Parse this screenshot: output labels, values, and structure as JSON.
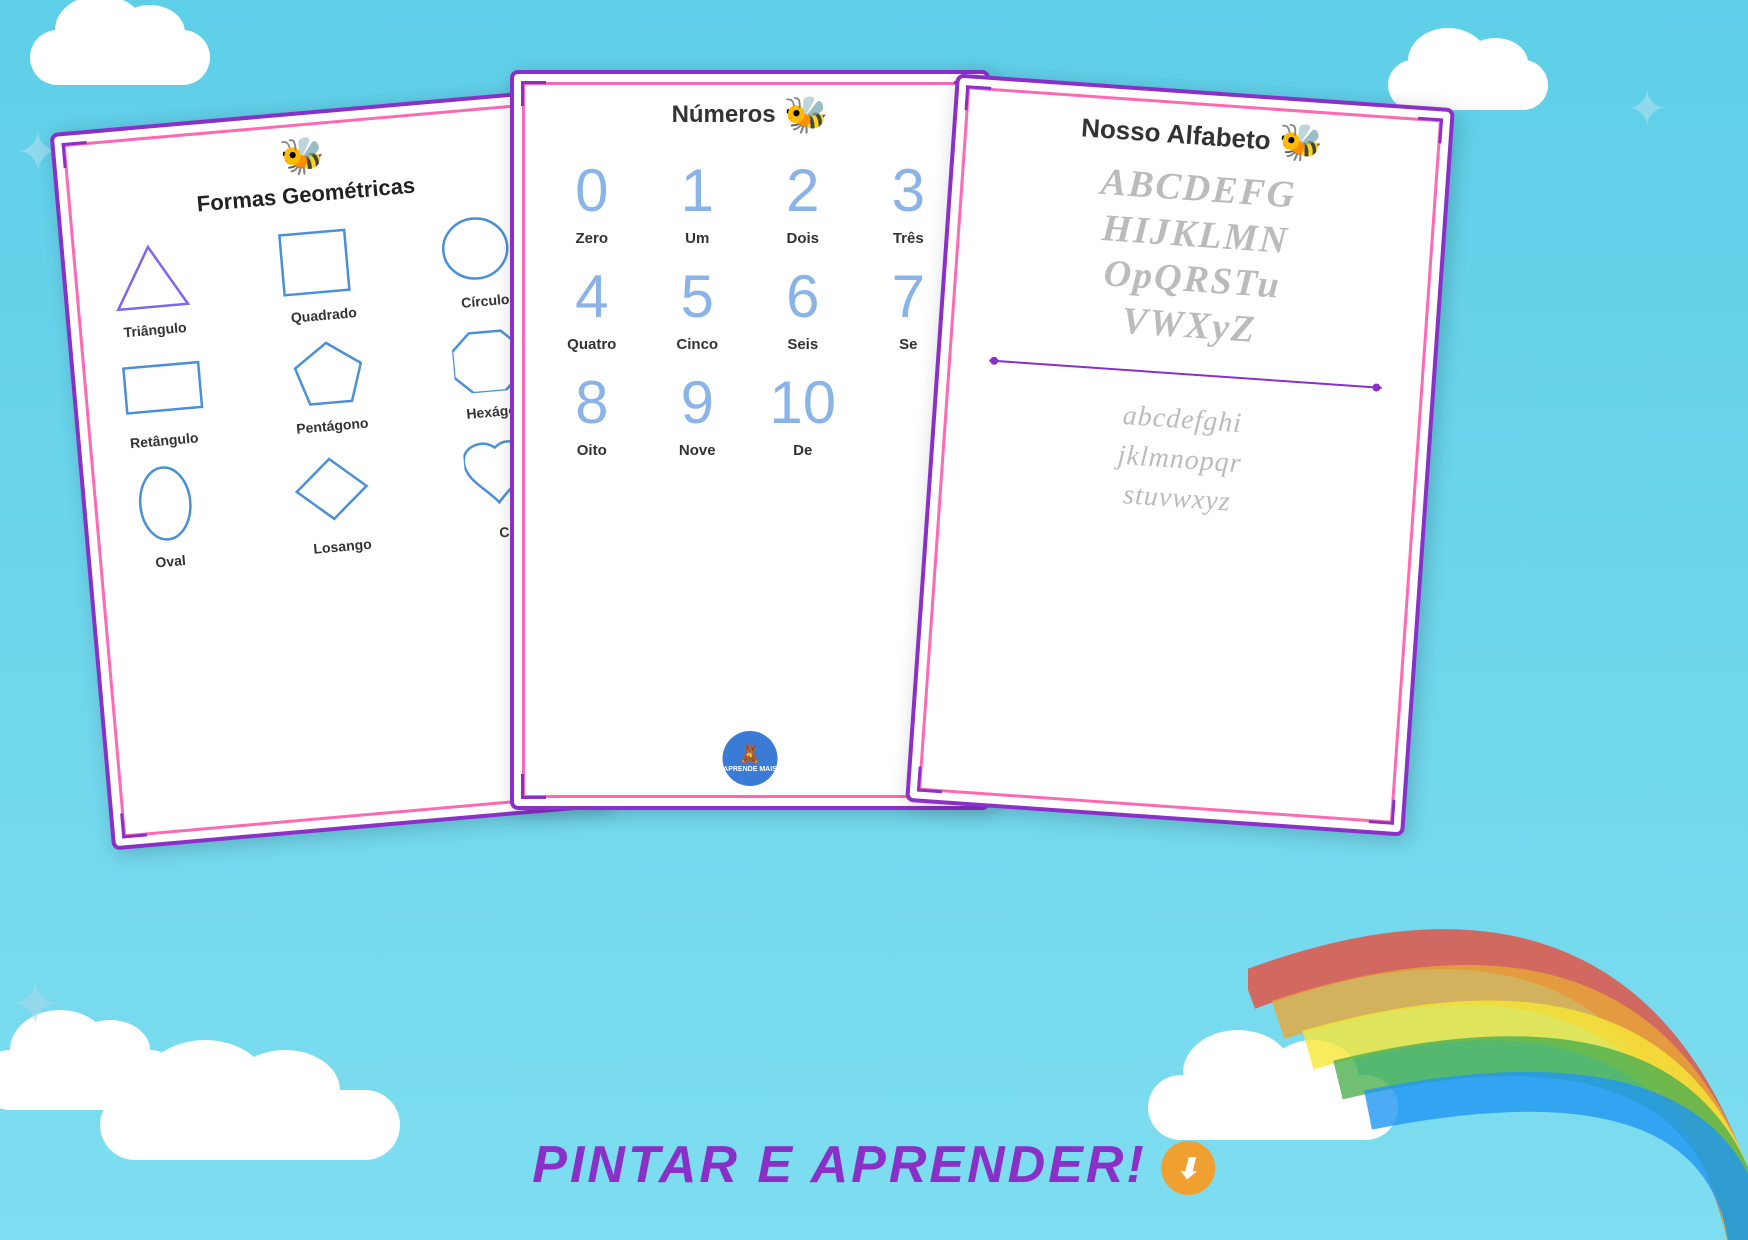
{
  "background": {
    "color": "#5ecfe8"
  },
  "page1": {
    "title": "Formas Geométricas",
    "shapes": [
      {
        "name": "Triângulo",
        "type": "triangle"
      },
      {
        "name": "Quadrado",
        "type": "square"
      },
      {
        "name": "Círculo",
        "type": "circle"
      },
      {
        "name": "Retângulo",
        "type": "rectangle"
      },
      {
        "name": "Pentágono",
        "type": "pentagon"
      },
      {
        "name": "Hexágon",
        "type": "hexagon"
      },
      {
        "name": "Oval",
        "type": "oval"
      },
      {
        "name": "Losango",
        "type": "diamond"
      },
      {
        "name": "Co",
        "type": "heart"
      }
    ]
  },
  "page2": {
    "title": "Números",
    "numbers": [
      {
        "char": "0",
        "label": "Zero"
      },
      {
        "char": "1",
        "label": "Um"
      },
      {
        "char": "2",
        "label": "Dois"
      },
      {
        "char": "3",
        "label": "Três"
      },
      {
        "char": "4",
        "label": "Quatro"
      },
      {
        "char": "5",
        "label": "Cinco"
      },
      {
        "char": "6",
        "label": "Seis"
      },
      {
        "char": "7",
        "label": "Se"
      },
      {
        "char": "8",
        "label": "Oito"
      },
      {
        "char": "9",
        "label": "Nove"
      },
      {
        "char": "10",
        "label": "De"
      }
    ]
  },
  "page3": {
    "title": "Nosso Alfabeto",
    "upper": "ABCDEFG\nHIJKLMN\nOpQRSTu\nVWXYZ",
    "lower": "abcdefghi\njklmnopqr\nstuvwxyz"
  },
  "footer": {
    "text": "PINTAR E APRENDER!"
  },
  "bee_emoji": "🐝",
  "download_emoji": "⬇️"
}
